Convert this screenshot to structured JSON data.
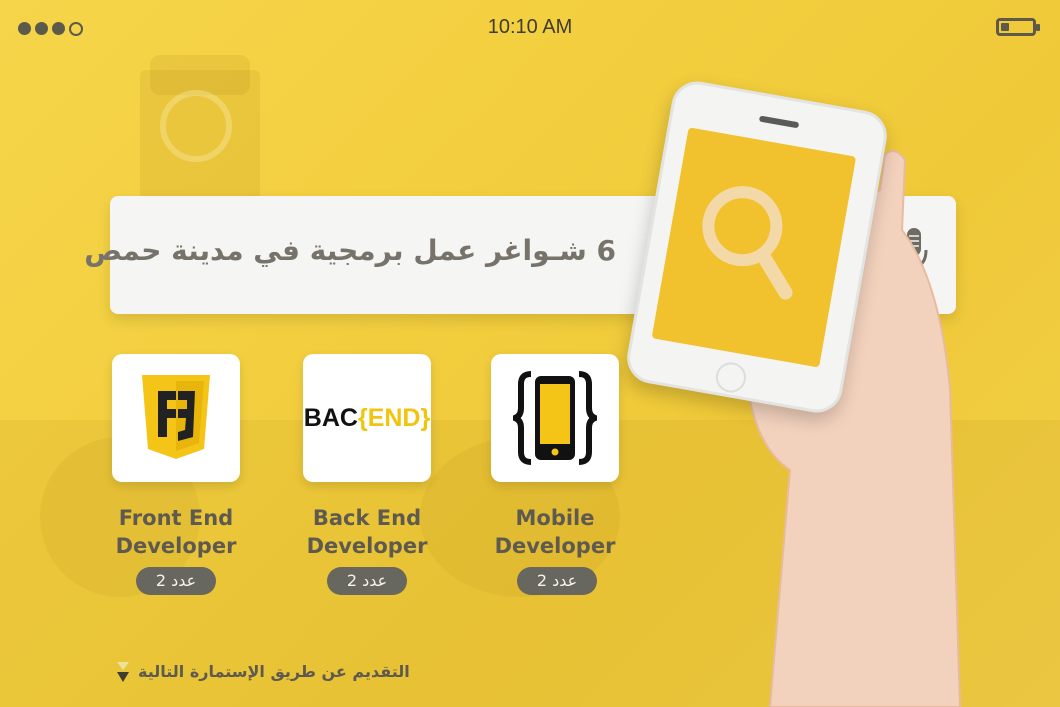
{
  "status_bar": {
    "time": "10:10 AM",
    "signal_dots": 4,
    "signal_filled": 3,
    "battery_level": 0.25
  },
  "search": {
    "query": "6 شـواغر عمل برمجية في مدينة حمص",
    "icon": "microphone-icon"
  },
  "cards": [
    {
      "title_line1": "Front End",
      "title_line2": "Developer",
      "badge": "عدد 2",
      "icon": "css3-shield-icon"
    },
    {
      "title_line1": "Back End",
      "title_line2": "Developer",
      "badge": "عدد 2",
      "logo_prefix": "BAC",
      "logo_bracket": "{",
      "logo_suffix": "END",
      "logo_close": "}"
    },
    {
      "title_line1": "Mobile",
      "title_line2": "Developer",
      "badge": "عدد 2",
      "icon": "mobile-brackets-icon"
    }
  ],
  "footer": {
    "text": "التقديم عن طريق الإستمارة التالية"
  },
  "colors": {
    "background": "#f3cf3f",
    "accent_yellow": "#f1c40f",
    "text_dark": "#5e5a4f",
    "badge_bg": "#67665f"
  }
}
